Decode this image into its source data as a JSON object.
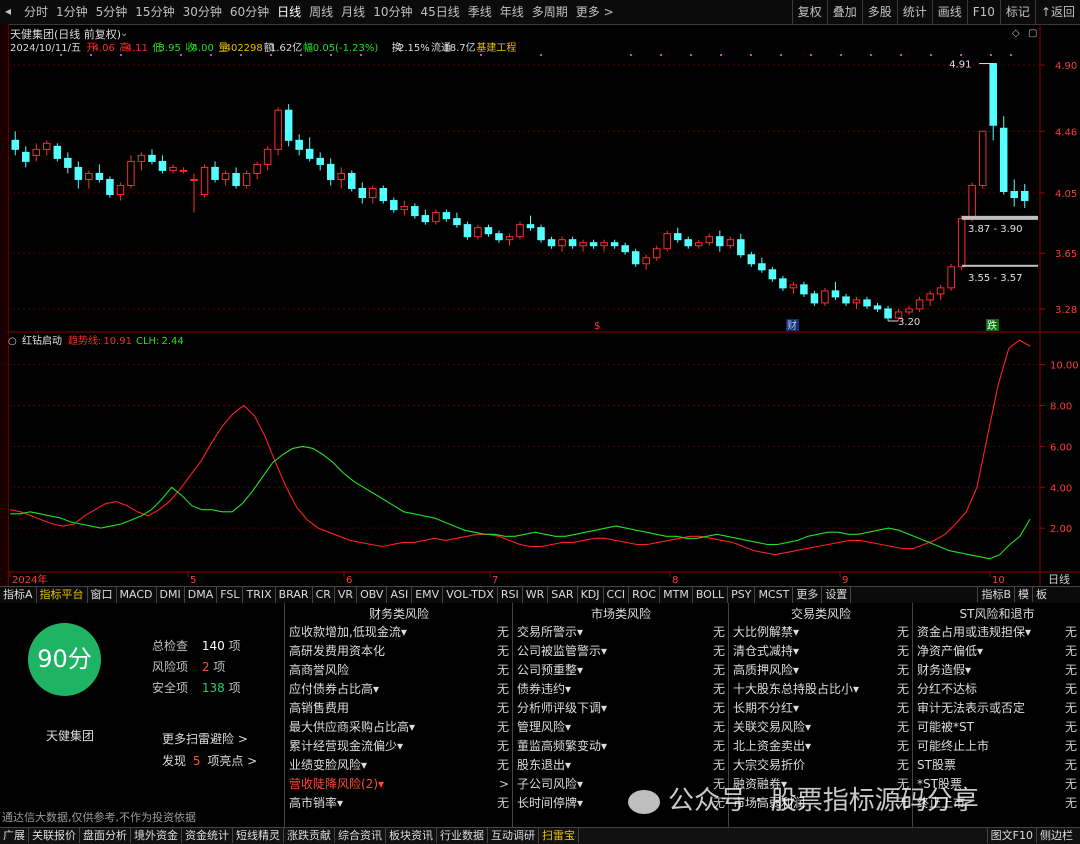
{
  "toolbar": {
    "periods": [
      "分时",
      "1分钟",
      "5分钟",
      "15分钟",
      "30分钟",
      "60分钟",
      "日线",
      "周线",
      "月线",
      "10分钟",
      "45日线",
      "季线",
      "年线",
      "多周期",
      "更多 >"
    ],
    "active_period": "日线",
    "right_tools": [
      "复权",
      "叠加",
      "多股",
      "统计",
      "画线",
      "F10",
      "标记",
      "↑返回"
    ]
  },
  "stock": {
    "name_line": "天健集团(日线 前复权)",
    "date": "2024/10/11/五",
    "open_label": "开",
    "open": "4.06",
    "high_label": "高",
    "high": "4.11",
    "low_label": "低",
    "low": "3.95",
    "close_label": "收",
    "close": "4.00",
    "vol_label": "量",
    "vol": "402298",
    "amount_label": "额",
    "amount": "1.62亿",
    "change_label": "幅",
    "change": "-0.05(-1.23%)",
    "turnover_label": "换",
    "turnover": "2.15%",
    "float_label": "流通",
    "float": "18.7亿",
    "sector": "基建工程"
  },
  "indicator": {
    "name": "红钻启动",
    "s1_label": "趋势线:",
    "s1_value": "10.91",
    "s2_label": "CLH:",
    "s2_value": "2.44"
  },
  "chart_data": [
    {
      "type": "candlestick",
      "title": "天健集团(日线 前复权)",
      "price_axis": [
        "4.90",
        "4.46",
        "4.05",
        "3.65",
        "3.28"
      ],
      "annotations": {
        "high": "4.91",
        "low": "3.20",
        "box1": "3.87 - 3.90",
        "box2": "3.55 - 3.57"
      },
      "markers": {
        "s": "$",
        "c": "财",
        "d": "跌"
      },
      "ohlc": [
        [
          4.4,
          4.46,
          4.3,
          4.34
        ],
        [
          4.32,
          4.36,
          4.22,
          4.26
        ],
        [
          4.3,
          4.38,
          4.26,
          4.34
        ],
        [
          4.34,
          4.4,
          4.3,
          4.38
        ],
        [
          4.36,
          4.38,
          4.26,
          4.28
        ],
        [
          4.28,
          4.32,
          4.18,
          4.22
        ],
        [
          4.22,
          4.26,
          4.08,
          4.14
        ],
        [
          4.14,
          4.2,
          4.08,
          4.18
        ],
        [
          4.18,
          4.24,
          4.12,
          4.14
        ],
        [
          4.14,
          4.16,
          4.02,
          4.04
        ],
        [
          4.04,
          4.12,
          4.0,
          4.1
        ],
        [
          4.1,
          4.3,
          4.08,
          4.26
        ],
        [
          4.26,
          4.32,
          4.2,
          4.3
        ],
        [
          4.3,
          4.34,
          4.24,
          4.26
        ],
        [
          4.26,
          4.3,
          4.18,
          4.2
        ],
        [
          4.2,
          4.24,
          4.18,
          4.22
        ],
        [
          4.2,
          4.22,
          4.18,
          4.2
        ],
        [
          4.14,
          4.18,
          3.92,
          4.14
        ],
        [
          4.04,
          4.24,
          4.02,
          4.22
        ],
        [
          4.22,
          4.26,
          4.12,
          4.14
        ],
        [
          4.14,
          4.2,
          4.1,
          4.18
        ],
        [
          4.18,
          4.22,
          4.08,
          4.1
        ],
        [
          4.1,
          4.2,
          4.08,
          4.18
        ],
        [
          4.18,
          4.26,
          4.14,
          4.24
        ],
        [
          4.24,
          4.36,
          4.2,
          4.34
        ],
        [
          4.34,
          4.62,
          4.3,
          4.6
        ],
        [
          4.6,
          4.64,
          4.36,
          4.4
        ],
        [
          4.4,
          4.44,
          4.3,
          4.34
        ],
        [
          4.34,
          4.42,
          4.26,
          4.28
        ],
        [
          4.28,
          4.32,
          4.2,
          4.24
        ],
        [
          4.24,
          4.28,
          4.1,
          4.14
        ],
        [
          4.14,
          4.22,
          4.08,
          4.18
        ],
        [
          4.18,
          4.2,
          4.06,
          4.08
        ],
        [
          4.08,
          4.12,
          3.98,
          4.02
        ],
        [
          4.02,
          4.1,
          3.98,
          4.08
        ],
        [
          4.08,
          4.1,
          3.98,
          4.0
        ],
        [
          4.0,
          4.02,
          3.92,
          3.94
        ],
        [
          3.94,
          4.0,
          3.9,
          3.96
        ],
        [
          3.96,
          3.98,
          3.88,
          3.9
        ],
        [
          3.9,
          3.94,
          3.84,
          3.86
        ],
        [
          3.86,
          3.94,
          3.84,
          3.92
        ],
        [
          3.92,
          3.94,
          3.86,
          3.88
        ],
        [
          3.88,
          3.92,
          3.82,
          3.84
        ],
        [
          3.84,
          3.86,
          3.74,
          3.76
        ],
        [
          3.76,
          3.84,
          3.74,
          3.82
        ],
        [
          3.82,
          3.84,
          3.76,
          3.78
        ],
        [
          3.78,
          3.8,
          3.72,
          3.74
        ],
        [
          3.74,
          3.78,
          3.7,
          3.76
        ],
        [
          3.76,
          3.86,
          3.74,
          3.84
        ],
        [
          3.84,
          3.9,
          3.8,
          3.82
        ],
        [
          3.82,
          3.84,
          3.72,
          3.74
        ],
        [
          3.74,
          3.76,
          3.68,
          3.7
        ],
        [
          3.7,
          3.76,
          3.66,
          3.74
        ],
        [
          3.74,
          3.76,
          3.68,
          3.7
        ],
        [
          3.7,
          3.74,
          3.66,
          3.72
        ],
        [
          3.72,
          3.74,
          3.68,
          3.7
        ],
        [
          3.7,
          3.74,
          3.66,
          3.72
        ],
        [
          3.72,
          3.74,
          3.68,
          3.7
        ],
        [
          3.7,
          3.72,
          3.64,
          3.66
        ],
        [
          3.66,
          3.68,
          3.56,
          3.58
        ],
        [
          3.58,
          3.64,
          3.54,
          3.62
        ],
        [
          3.62,
          3.7,
          3.6,
          3.68
        ],
        [
          3.68,
          3.8,
          3.66,
          3.78
        ],
        [
          3.78,
          3.82,
          3.72,
          3.74
        ],
        [
          3.74,
          3.76,
          3.68,
          3.7
        ],
        [
          3.7,
          3.74,
          3.68,
          3.72
        ],
        [
          3.72,
          3.78,
          3.7,
          3.76
        ],
        [
          3.76,
          3.8,
          3.66,
          3.7
        ],
        [
          3.7,
          3.76,
          3.68,
          3.74
        ],
        [
          3.74,
          3.78,
          3.62,
          3.64
        ],
        [
          3.64,
          3.66,
          3.56,
          3.58
        ],
        [
          3.58,
          3.62,
          3.52,
          3.54
        ],
        [
          3.54,
          3.56,
          3.46,
          3.48
        ],
        [
          3.48,
          3.5,
          3.4,
          3.42
        ],
        [
          3.42,
          3.46,
          3.38,
          3.44
        ],
        [
          3.44,
          3.46,
          3.36,
          3.38
        ],
        [
          3.38,
          3.4,
          3.3,
          3.32
        ],
        [
          3.32,
          3.42,
          3.3,
          3.4
        ],
        [
          3.4,
          3.46,
          3.34,
          3.36
        ],
        [
          3.36,
          3.38,
          3.3,
          3.32
        ],
        [
          3.32,
          3.36,
          3.28,
          3.34
        ],
        [
          3.34,
          3.36,
          3.28,
          3.3
        ],
        [
          3.3,
          3.32,
          3.26,
          3.28
        ],
        [
          3.28,
          3.3,
          3.2,
          3.22
        ],
        [
          3.22,
          3.28,
          3.2,
          3.26
        ],
        [
          3.26,
          3.3,
          3.24,
          3.28
        ],
        [
          3.28,
          3.36,
          3.26,
          3.34
        ],
        [
          3.34,
          3.4,
          3.3,
          3.38
        ],
        [
          3.38,
          3.44,
          3.34,
          3.42
        ],
        [
          3.42,
          3.58,
          3.4,
          3.56
        ],
        [
          3.56,
          3.9,
          3.54,
          3.88
        ],
        [
          3.88,
          4.12,
          3.86,
          4.1
        ],
        [
          4.1,
          4.46,
          4.08,
          4.46
        ],
        [
          4.91,
          4.91,
          4.4,
          4.5
        ],
        [
          4.48,
          4.56,
          4.04,
          4.06
        ],
        [
          4.06,
          4.14,
          3.96,
          4.02
        ],
        [
          4.06,
          4.11,
          3.95,
          4.0
        ]
      ]
    },
    {
      "type": "line",
      "title": "红钻启动",
      "y_ticks": [
        "10.00",
        "8.00",
        "6.00",
        "4.00",
        "2.00"
      ],
      "ylim": [
        0,
        11.5
      ],
      "x_labels": [
        "2024年",
        "5",
        "6",
        "7",
        "8",
        "9",
        "10"
      ],
      "series": [
        {
          "name": "趋势线",
          "color": "#ff2020",
          "values": [
            2.9,
            2.8,
            2.6,
            2.4,
            2.2,
            2.1,
            2.2,
            2.6,
            2.9,
            3.2,
            3.3,
            3.1,
            2.8,
            2.6,
            2.9,
            3.3,
            3.9,
            4.6,
            5.3,
            6.2,
            7.0,
            7.6,
            8.0,
            7.5,
            6.5,
            5.2,
            4.0,
            3.0,
            2.4,
            2.0,
            1.8,
            1.6,
            1.4,
            1.3,
            1.2,
            1.1,
            1.2,
            1.3,
            1.3,
            1.4,
            1.5,
            1.4,
            1.5,
            1.6,
            1.7,
            1.7,
            1.6,
            1.4,
            1.2,
            1.1,
            1.1,
            1.2,
            1.3,
            1.3,
            1.4,
            1.5,
            1.5,
            1.4,
            1.3,
            1.2,
            1.2,
            1.3,
            1.4,
            1.5,
            1.6,
            1.6,
            1.5,
            1.4,
            1.3,
            1.1,
            0.9,
            0.8,
            0.7,
            0.8,
            0.9,
            1.0,
            1.1,
            1.2,
            1.3,
            1.4,
            1.4,
            1.3,
            1.2,
            1.1,
            1.0,
            1.0,
            1.2,
            1.4,
            1.7,
            2.2,
            2.8,
            4.0,
            6.5,
            9.0,
            10.8,
            11.2,
            10.91
          ]
        },
        {
          "name": "CLH",
          "color": "#22e022",
          "values": [
            2.7,
            2.7,
            2.8,
            2.7,
            2.6,
            2.5,
            2.3,
            2.2,
            2.1,
            2.0,
            2.1,
            2.2,
            2.4,
            2.6,
            2.9,
            3.4,
            4.0,
            3.6,
            3.1,
            2.9,
            2.9,
            2.8,
            2.8,
            3.2,
            3.8,
            4.5,
            5.2,
            5.6,
            5.9,
            6.0,
            5.9,
            5.6,
            5.2,
            4.7,
            4.3,
            4.0,
            3.7,
            3.4,
            3.1,
            2.8,
            2.7,
            2.6,
            2.5,
            2.3,
            2.1,
            1.9,
            1.8,
            1.7,
            1.7,
            1.6,
            1.6,
            1.7,
            1.8,
            1.7,
            1.6,
            1.6,
            1.7,
            1.8,
            1.9,
            2.0,
            2.1,
            2.0,
            1.9,
            1.8,
            1.7,
            1.6,
            1.6,
            1.5,
            1.5,
            1.6,
            1.7,
            1.6,
            1.5,
            1.4,
            1.3,
            1.2,
            1.2,
            1.3,
            1.4,
            1.6,
            1.7,
            1.8,
            1.8,
            1.7,
            1.7,
            1.8,
            1.9,
            2.0,
            1.9,
            1.7,
            1.5,
            1.3,
            1.1,
            0.9,
            0.8,
            0.7,
            0.6,
            0.5,
            0.7,
            1.2,
            1.6,
            2.44
          ]
        }
      ]
    }
  ],
  "indicator_tabs": [
    "指标A",
    "指标平台",
    "窗口",
    "MACD",
    "DMI",
    "DMA",
    "FSL",
    "TRIX",
    "BRAR",
    "CR",
    "VR",
    "OBV",
    "ASI",
    "EMV",
    "VOL-TDX",
    "RSI",
    "WR",
    "SAR",
    "KDJ",
    "CCI",
    "ROC",
    "MTM",
    "BOLL",
    "PSY",
    "MCST",
    "更多",
    "设置"
  ],
  "active_indicator_tab": "指标平台",
  "indicator_tabs_right": [
    "指标B",
    "模",
    "板"
  ],
  "risk": {
    "score": "90分",
    "stock_name": "天健集团",
    "total_label": "总检查",
    "total": "140",
    "unit": "项",
    "risk_label": "风险项",
    "risk": "2",
    "safe_label": "安全项",
    "safe": "138",
    "more_link": "更多扫雷避险 >",
    "find_label": "发现",
    "find_count": "5",
    "find_suffix": "项亮点 >",
    "disclaimer": "通达信大数据,仅供参考,不作为投资依据",
    "columns": [
      {
        "title": "财务类风险",
        "items": [
          [
            "应收款增加,低现金流▾",
            "无"
          ],
          [
            "高研发费用资本化",
            "无"
          ],
          [
            "高商誉风险",
            "无"
          ],
          [
            "应付债券占比高▾",
            "无"
          ],
          [
            "高销售费用",
            "无"
          ],
          [
            "最大供应商采购占比高▾",
            "无"
          ],
          [
            "累计经营现金流偏少▾",
            "无"
          ],
          [
            "业绩变脸风险▾",
            "无"
          ],
          [
            "营收陡降风险(2)▾",
            ">"
          ],
          [
            "高市销率▾",
            "无"
          ]
        ]
      },
      {
        "title": "市场类风险",
        "items": [
          [
            "交易所警示▾",
            "无"
          ],
          [
            "公司被监管警示▾",
            "无"
          ],
          [
            "公司预重整▾",
            "无"
          ],
          [
            "债券违约▾",
            "无"
          ],
          [
            "分析师评级下调▾",
            "无"
          ],
          [
            "管理风险▾",
            "无"
          ],
          [
            "董监高频繁变动▾",
            "无"
          ],
          [
            "股东退出▾",
            "无"
          ],
          [
            "子公司风险▾",
            "无"
          ],
          [
            "长时间停牌▾",
            "无"
          ]
        ]
      },
      {
        "title": "交易类风险",
        "items": [
          [
            "大比例解禁▾",
            "无"
          ],
          [
            "清仓式减持▾",
            "无"
          ],
          [
            "高质押风险▾",
            "无"
          ],
          [
            "十大股东总持股占比小▾",
            "无"
          ],
          [
            "长期不分红▾",
            "无"
          ],
          [
            "关联交易风险▾",
            "无"
          ],
          [
            "北上资金卖出▾",
            "无"
          ],
          [
            "大宗交易折价",
            "无"
          ],
          [
            "融资融券▾",
            "无"
          ],
          [
            "市场高弱利润",
            "无"
          ]
        ]
      },
      {
        "title": "ST风险和退市",
        "items": [
          [
            "资金占用或违规担保▾",
            "无"
          ],
          [
            "净资产偏低▾",
            "无"
          ],
          [
            "财务造假▾",
            "无"
          ],
          [
            "分红不达标",
            "无"
          ],
          [
            "审计无法表示或否定",
            "无"
          ],
          [
            "可能被*ST",
            "无"
          ],
          [
            "可能终止上市",
            "无"
          ],
          [
            "ST股票",
            "无"
          ],
          [
            "*ST股票",
            "无"
          ],
          [
            "终止上市",
            "无"
          ]
        ]
      }
    ]
  },
  "footer_tabs": [
    "广展",
    "关联报价",
    "盘面分析",
    "境外资金",
    "资金统计",
    "短线精灵",
    "涨跌贡献",
    "综合资讯",
    "板块资讯",
    "行业数据",
    "互动调研",
    "扫雷宝"
  ],
  "footer_right": [
    "图文F10",
    "侧边栏"
  ],
  "watermark": "公众号 · 股票指标源码分享",
  "colors": {
    "up": "#ff2a2a",
    "down": "#54ffff",
    "panel_bg": "#000000",
    "score_green": "#1fb463",
    "sector_yellow": "#e8c000",
    "risk_red": "#ff4a36"
  }
}
